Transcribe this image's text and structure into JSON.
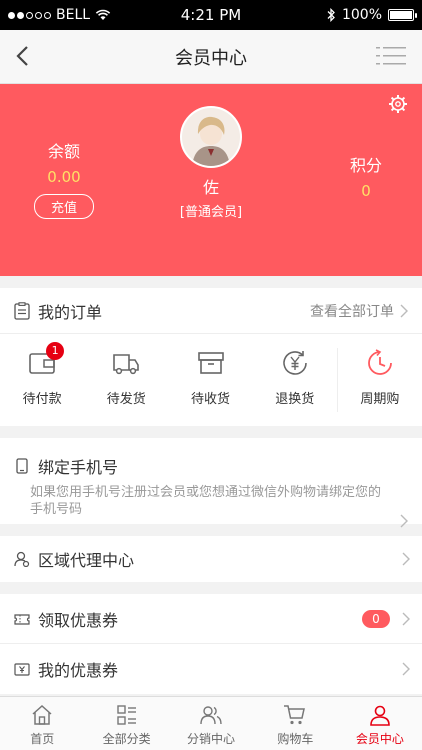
{
  "status_bar": {
    "carrier": "BELL",
    "time": "4:21 PM",
    "battery": "100%",
    "battery_level": 1.0
  },
  "nav": {
    "title": "会员中心"
  },
  "member": {
    "balance_label": "余额",
    "balance_value": "0.00",
    "recharge_label": "充值",
    "name": "佐",
    "level": "[普通会员]",
    "points_label": "积分",
    "points_value": "0"
  },
  "orders": {
    "title": "我的订单",
    "view_all": "查看全部订单",
    "items": [
      {
        "label": "待付款",
        "badge": "1"
      },
      {
        "label": "待发货"
      },
      {
        "label": "待收货"
      },
      {
        "label": "退换货"
      },
      {
        "label": "周期购"
      }
    ]
  },
  "bind_phone": {
    "title": "绑定手机号",
    "desc": "如果您用手机号注册过会员或您想通过微信外购物请绑定您的手机号码"
  },
  "agent": {
    "title": "区域代理中心"
  },
  "coupons": {
    "get_title": "领取优惠券",
    "get_count": "0",
    "my_title": "我的优惠券"
  },
  "tabbar": {
    "items": [
      {
        "label": "首页",
        "icon": "home-icon"
      },
      {
        "label": "全部分类",
        "icon": "category-icon"
      },
      {
        "label": "分销中心",
        "icon": "users-icon"
      },
      {
        "label": "购物车",
        "icon": "cart-icon"
      },
      {
        "label": "会员中心",
        "icon": "user-icon",
        "active": true
      }
    ]
  },
  "colors": {
    "accent": "#ff5a5f",
    "active": "#e60012",
    "value_yellow": "#ffe066"
  }
}
